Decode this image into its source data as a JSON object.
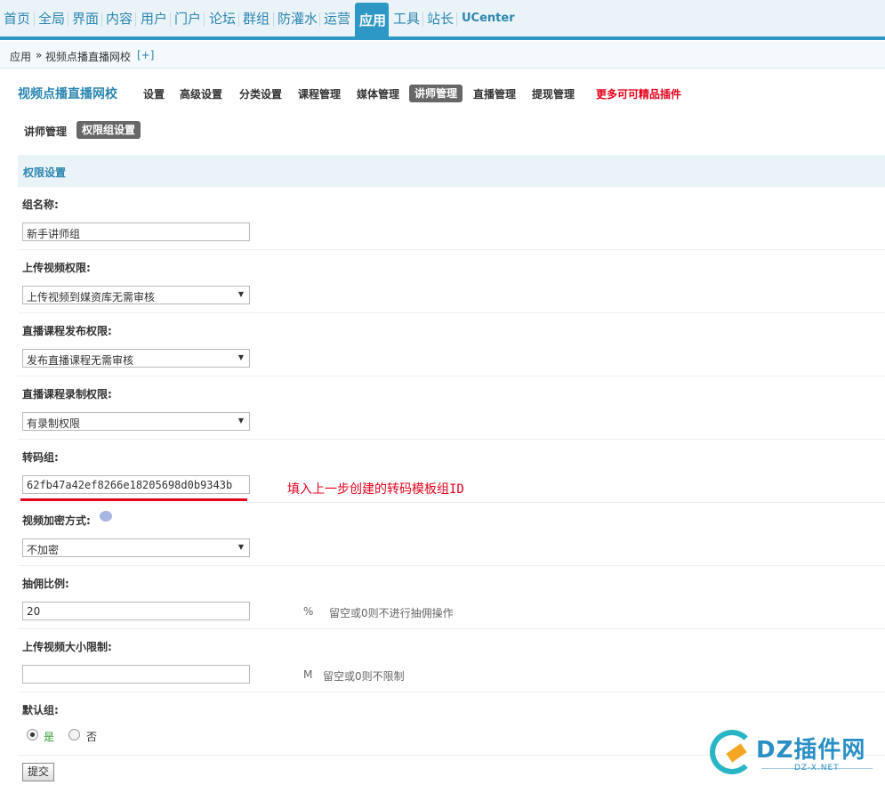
{
  "topnav": {
    "items": [
      "首页",
      "全局",
      "界面",
      "内容",
      "用户",
      "门户",
      "论坛",
      "群组",
      "防灌水",
      "运营",
      "应用",
      "工具",
      "站长",
      "UCenter"
    ],
    "active": "应用"
  },
  "breadcrumb": {
    "root": "应用",
    "sep": "»",
    "current": "视频点播直播网校",
    "add": "[+]"
  },
  "plugin_nav": {
    "title": "视频点播直播网校",
    "links": [
      "设置",
      "高级设置",
      "分类设置",
      "课程管理",
      "媒体管理",
      "讲师管理",
      "直播管理",
      "提现管理",
      "更多可可精品插件"
    ],
    "active": "讲师管理"
  },
  "sub_nav": {
    "link": "讲师管理",
    "active": "权限组设置"
  },
  "section": {
    "title": "权限设置"
  },
  "form": {
    "group_name": {
      "label": "组名称:",
      "value": "新手讲师组"
    },
    "upload_perm": {
      "label": "上传视频权限:",
      "value": "上传视频到媒资库无需审核"
    },
    "live_publish_perm": {
      "label": "直播课程发布权限:",
      "value": "发布直播课程无需审核"
    },
    "live_record_perm": {
      "label": "直播课程录制权限:",
      "value": "有录制权限"
    },
    "transcode_group": {
      "label": "转码组:",
      "value": "62fb47a42ef8266e18205698d0b9343b",
      "annotation": "填入上一步创建的转码模板组ID"
    },
    "encrypt": {
      "label": "视频加密方式:",
      "value": "不加密"
    },
    "commission": {
      "label": "抽佣比例:",
      "value": "20",
      "unit": "%",
      "hint": "留空或0则不进行抽佣操作"
    },
    "upload_limit": {
      "label": "上传视频大小限制:",
      "value": "",
      "unit": "M",
      "hint": "留空或0则不限制"
    },
    "default_group": {
      "label": "默认组:",
      "yes": "是",
      "no": "否",
      "selected": "是"
    },
    "submit": "提交"
  },
  "watermark": {
    "brand": "DZ插件网",
    "sub": "DZ-X.NET"
  },
  "colors": {
    "accent": "#2d98c6",
    "link": "#2b86b0",
    "red": "#e4001b",
    "yes_green": "#2e9d2e"
  }
}
